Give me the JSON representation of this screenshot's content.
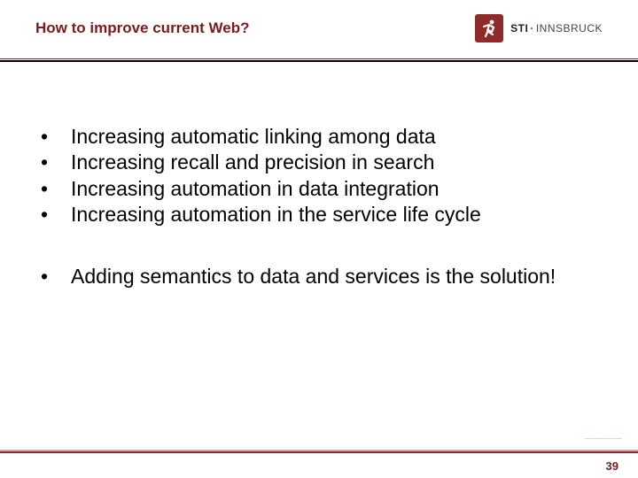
{
  "header": {
    "title": "How to improve current Web?",
    "logo": {
      "name_bold": "STI",
      "name_rest": "INNSBRUCK"
    }
  },
  "content": {
    "group1": [
      "Increasing automatic linking among data",
      "Increasing recall and precision in search",
      "Increasing automation in data integration",
      "Increasing automation in the service life cycle"
    ],
    "group2": [
      "Adding semantics to data and services is the solution!"
    ]
  },
  "footer": {
    "page_number": "39"
  },
  "colors": {
    "accent": "#8e2a2a"
  }
}
